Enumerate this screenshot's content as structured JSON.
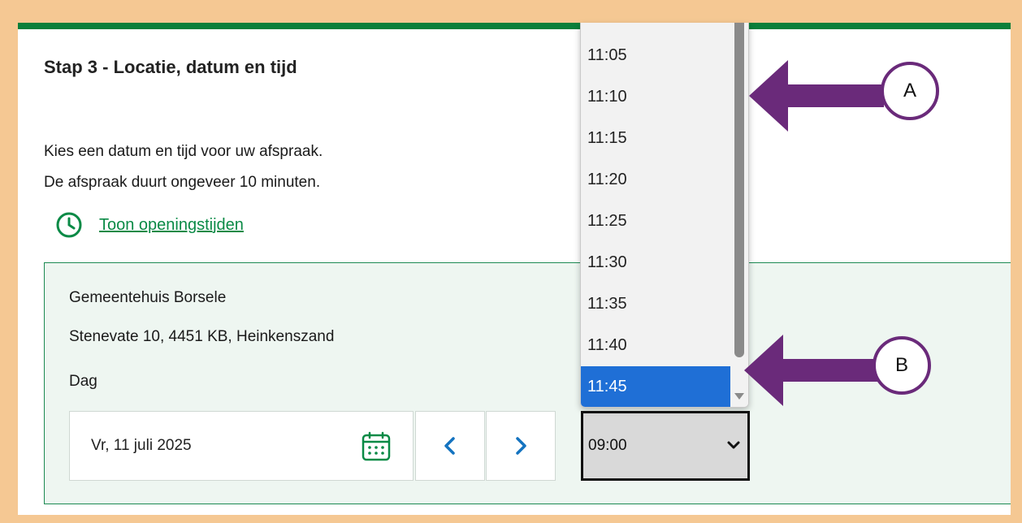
{
  "step": {
    "title": "Stap 3 - Locatie, datum en tijd"
  },
  "intro": {
    "line1": "Kies een datum en tijd voor uw afspraak.",
    "line2": "De afspraak duurt ongeveer 10 minuten."
  },
  "hours_link": {
    "label": "Toon openingstijden",
    "icon": "clock-icon"
  },
  "location": {
    "name": "Gemeentehuis Borsele",
    "address": "Stenevate 10, 4451 KB, Heinkenszand",
    "day_label": "Dag",
    "date_value": "Vr, 11 juli 2025",
    "calendar_icon": "calendar-icon",
    "prev_icon": "chevron-left-icon",
    "next_icon": "chevron-right-icon"
  },
  "time_select": {
    "value": "09:00",
    "options": [
      "11:05",
      "11:10",
      "11:15",
      "11:20",
      "11:25",
      "11:30",
      "11:35",
      "11:40",
      "11:45"
    ],
    "selected": "11:45"
  },
  "annotations": {
    "a": "A",
    "b": "B"
  },
  "colors": {
    "outer_background": "#f5c893",
    "brand_green": "#0a7f3a",
    "link_green": "#0a8a46",
    "panel_background": "#eef6f1",
    "selected_blue": "#1f6fd6",
    "arrow_purple": "#6a2a7a",
    "nav_blue": "#1473c0"
  }
}
